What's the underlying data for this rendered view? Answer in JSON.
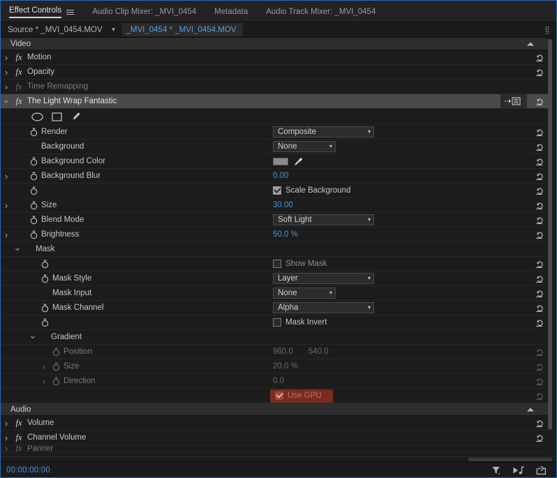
{
  "tabs": [
    {
      "label": "Effect Controls",
      "active": true,
      "menu_icon": "hamburger-menu-icon"
    },
    {
      "label": "Audio Clip Mixer: _MVI_0454",
      "active": false
    },
    {
      "label": "Metadata",
      "active": false
    },
    {
      "label": "Audio Track Mixer: _MVI_0454",
      "active": false
    }
  ],
  "sourcebar": {
    "source_label": "Source * _MVI_0454.MOV",
    "caret_icon": "chevron-down-icon",
    "clip_label": "_MVI_0454 * _MVI_0454.MOV",
    "grip_icon": "drag-grip-icon"
  },
  "video_section": {
    "title": "Video",
    "collapse_icon": "triangle-up-icon"
  },
  "effects": [
    {
      "name": "Motion",
      "expanded": false,
      "fx_enabled": true
    },
    {
      "name": "Opacity",
      "expanded": false,
      "fx_enabled": true
    },
    {
      "name": "Time Remapping",
      "expanded": false,
      "fx_enabled": false
    },
    {
      "name": "The Light Wrap Fantastic",
      "expanded": true,
      "fx_enabled": true,
      "selected": true,
      "options_icon": "effect-options-icon"
    }
  ],
  "mask_tools": [
    {
      "icon": "ellipse-mask-icon"
    },
    {
      "icon": "rectangle-mask-icon"
    },
    {
      "icon": "pen-tool-icon"
    }
  ],
  "params": [
    {
      "label": "Render",
      "stopwatch": true,
      "indent": 1,
      "control": "dropdown",
      "value": "Composite",
      "width": "wide",
      "reset": true
    },
    {
      "label": "Background",
      "stopwatch": false,
      "indent": 1,
      "control": "dropdown",
      "value": "None",
      "width": "narrow",
      "reset": true
    },
    {
      "label": "Background Color",
      "stopwatch": true,
      "indent": 1,
      "control": "color",
      "color": "#8a8a8a",
      "eyedropper_icon": "eyedropper-icon",
      "reset": true
    },
    {
      "label": "Background Blur",
      "stopwatch": true,
      "indent": 1,
      "expandable": true,
      "control": "number",
      "value": "0.00",
      "reset": true
    },
    {
      "label": "",
      "stopwatch": true,
      "indent": 1,
      "control": "checkbox",
      "checked": true,
      "checkbox_label": "Scale Background",
      "reset": true
    },
    {
      "label": "Size",
      "stopwatch": true,
      "indent": 1,
      "expandable": true,
      "control": "number",
      "value": "30.00",
      "reset": true
    },
    {
      "label": "Blend Mode",
      "stopwatch": true,
      "indent": 1,
      "control": "dropdown",
      "value": "Soft Light",
      "width": "wide",
      "reset": true
    },
    {
      "label": "Brightness",
      "stopwatch": true,
      "indent": 1,
      "expandable": true,
      "control": "number",
      "value": "50.0 %",
      "reset": true
    },
    {
      "label": "Mask",
      "stopwatch": false,
      "indent": 1,
      "group": true,
      "expanded": true,
      "control": "none",
      "reset": false
    },
    {
      "label": "",
      "stopwatch": true,
      "indent": 2,
      "control": "checkbox",
      "checked": false,
      "checkbox_label": "Show Mask",
      "checkbox_dim": true,
      "reset": true
    },
    {
      "label": "Mask Style",
      "stopwatch": true,
      "indent": 2,
      "control": "dropdown",
      "value": "Layer",
      "width": "wide",
      "reset": true
    },
    {
      "label": "Mask Input",
      "stopwatch": false,
      "indent": 2,
      "control": "dropdown",
      "value": "None",
      "width": "narrow",
      "reset": true
    },
    {
      "label": "Mask Channel",
      "stopwatch": true,
      "indent": 2,
      "control": "dropdown",
      "value": "Alpha",
      "width": "wide",
      "reset": true
    },
    {
      "label": "",
      "stopwatch": true,
      "indent": 2,
      "control": "checkbox",
      "checked": false,
      "checkbox_label": "Mask Invert",
      "reset": true
    },
    {
      "label": "Gradient",
      "stopwatch": false,
      "indent": 2,
      "group": true,
      "expanded": true,
      "control": "none",
      "reset": false
    },
    {
      "label": "Position",
      "stopwatch": true,
      "indent": 3,
      "dimmed": true,
      "control": "number2",
      "value": "960.0",
      "value2": "540.0",
      "reset": true
    },
    {
      "label": "Size",
      "stopwatch": true,
      "indent": 3,
      "dimmed": true,
      "expandable": true,
      "control": "number",
      "value": "20.0 %",
      "reset": true
    },
    {
      "label": "Direction",
      "stopwatch": true,
      "indent": 3,
      "dimmed": true,
      "expandable": true,
      "control": "number",
      "value": "0.0",
      "reset": true
    },
    {
      "label": "",
      "stopwatch": false,
      "indent": 1,
      "control": "gpu",
      "checked": true,
      "checkbox_label": "Use GPU",
      "reset": true
    }
  ],
  "audio_section": {
    "title": "Audio",
    "collapse_icon": "triangle-up-icon"
  },
  "audio_effects": [
    {
      "name": "Volume",
      "expanded": false
    },
    {
      "name": "Channel Volume",
      "expanded": false
    },
    {
      "name": "Panner",
      "expanded": false,
      "clipped": true
    }
  ],
  "bottombar": {
    "timecode": "00:00:00:00",
    "icons": [
      {
        "name": "filter-icon"
      },
      {
        "name": "play-audio-icon"
      },
      {
        "name": "export-frame-icon"
      }
    ]
  },
  "colors": {
    "accent_blue": "#4f93d6",
    "panel_bg": "#1c1c1c",
    "row_border": "#262626",
    "selected_row": "#4a4a4a",
    "gpu_red": "#7a2b20",
    "swatch_gray": "#8a8a8a"
  }
}
